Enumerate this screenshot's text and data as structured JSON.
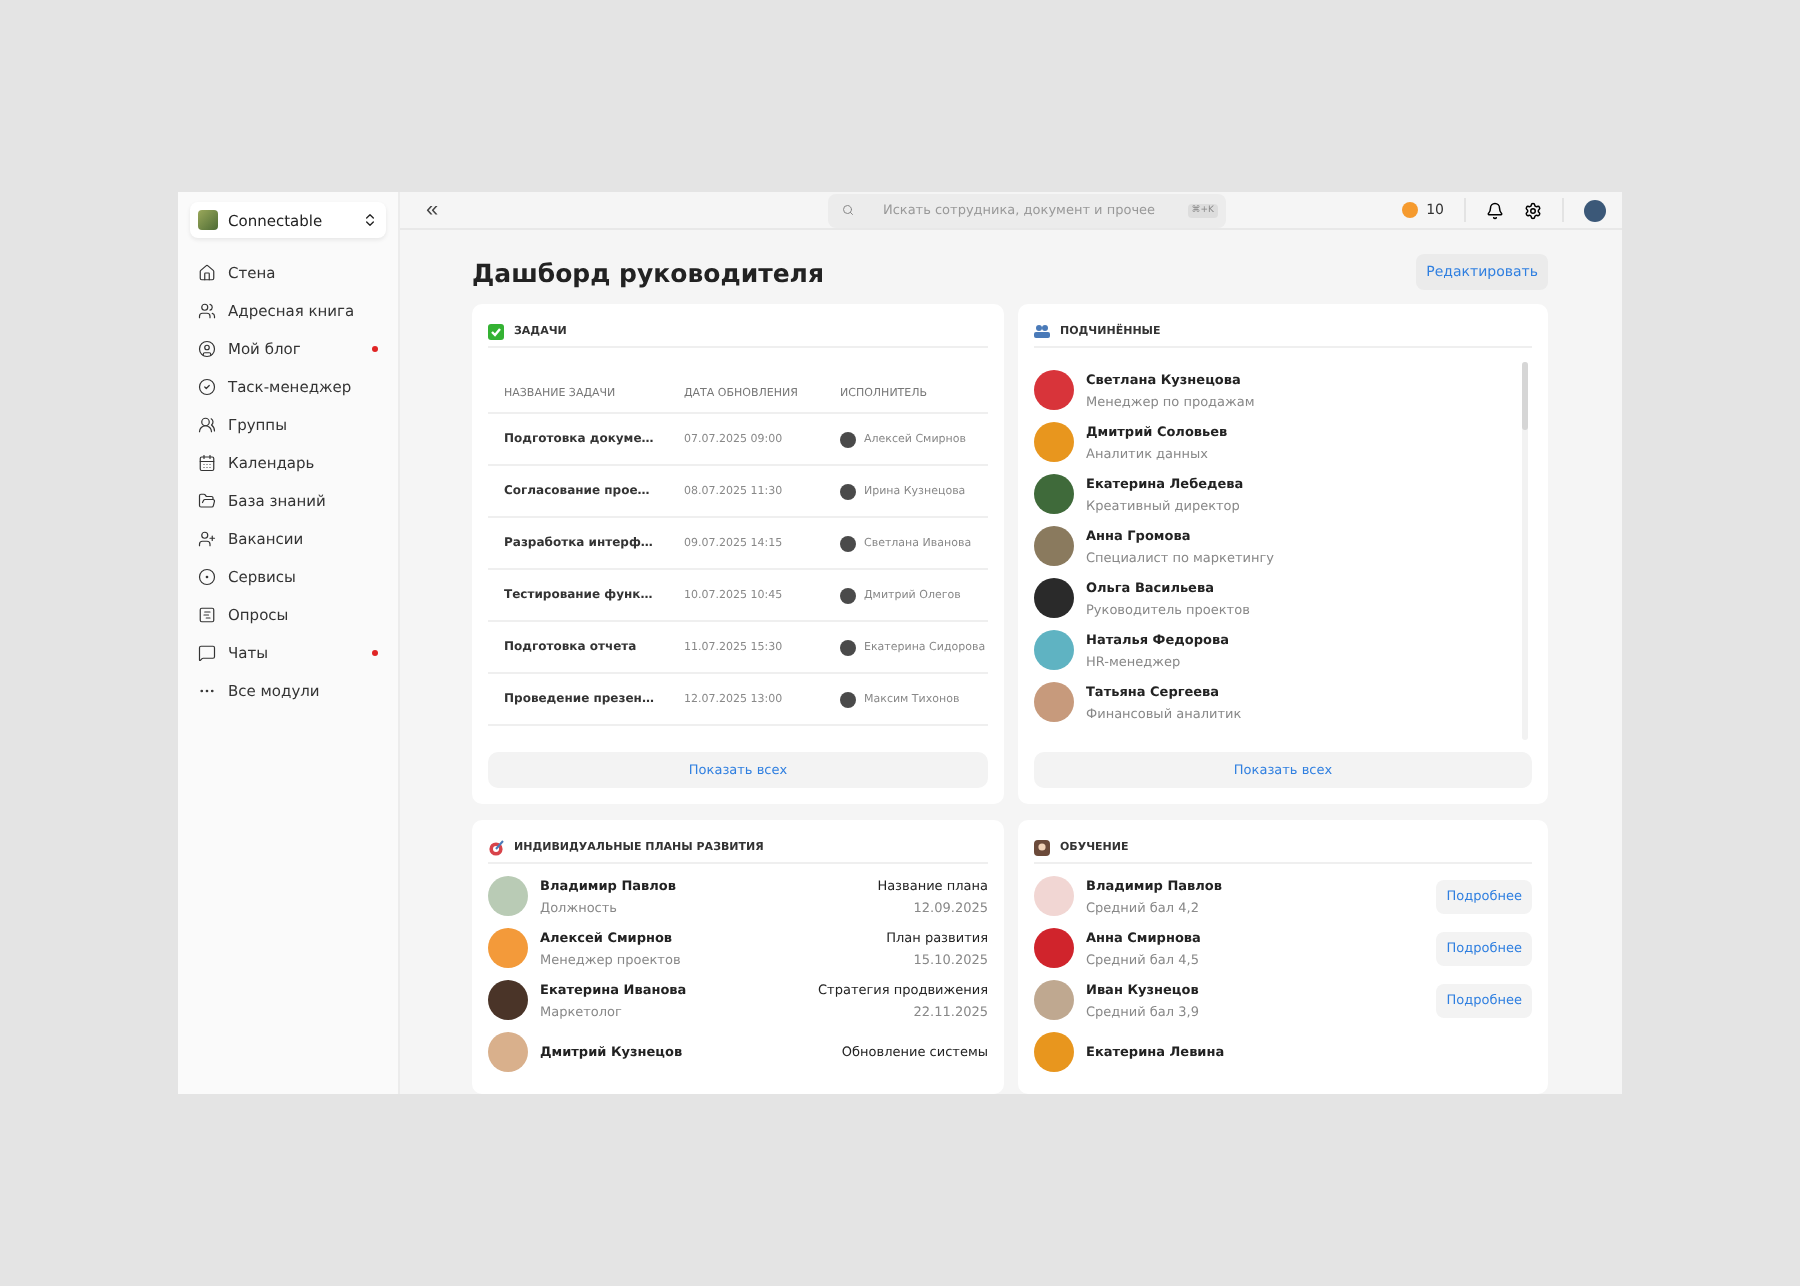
{
  "workspace": {
    "name": "Connectable"
  },
  "sidebar": {
    "items": [
      {
        "label": "Стена",
        "unread": false
      },
      {
        "label": "Адресная книга",
        "unread": false
      },
      {
        "label": "Мой блог",
        "unread": true
      },
      {
        "label": "Таск-менеджер",
        "unread": false
      },
      {
        "label": "Группы",
        "unread": false
      },
      {
        "label": "Календарь",
        "unread": false
      },
      {
        "label": "База знаний",
        "unread": false
      },
      {
        "label": "Вакансии",
        "unread": false
      },
      {
        "label": "Сервисы",
        "unread": false
      },
      {
        "label": "Опросы",
        "unread": false
      },
      {
        "label": "Чаты",
        "unread": true
      },
      {
        "label": "Все модули",
        "unread": false
      }
    ]
  },
  "topbar": {
    "collapse": "«",
    "search": {
      "placeholder": "Искать сотрудника, документ и прочее",
      "shortcut": "⌘+K"
    },
    "coins": "10"
  },
  "page": {
    "title": "Дашборд руководителя",
    "edit_button": "Редактировать"
  },
  "tasks": {
    "title": "ЗАДАЧИ",
    "columns": [
      "НАЗВАНИЕ ЗАДАЧИ",
      "ДАТА ОБНОВЛЕНИЯ",
      "ИСПОЛНИТЕЛЬ"
    ],
    "rows": [
      {
        "name": "Подготовка докуме…",
        "date": "07.07.2025 09:00",
        "assignee": "Алексей Смирнов"
      },
      {
        "name": "Согласование прое…",
        "date": "08.07.2025 11:30",
        "assignee": "Ирина Кузнецова"
      },
      {
        "name": "Разработка интерф…",
        "date": "09.07.2025 14:15",
        "assignee": "Светлана Иванова"
      },
      {
        "name": "Тестирование функ…",
        "date": "10.07.2025 10:45",
        "assignee": "Дмитрий Олегов"
      },
      {
        "name": "Подготовка отчета",
        "date": "11.07.2025 15:30",
        "assignee": "Екатерина Сидорова"
      },
      {
        "name": "Проведение презен…",
        "date": "12.07.2025 13:00",
        "assignee": "Максим Тихонов"
      }
    ],
    "show_all": "Показать всех"
  },
  "subordinates": {
    "title": "ПОДЧИНЁННЫЕ",
    "people": [
      {
        "name": "Светлана Кузнецова",
        "role": "Менеджер по продажам",
        "color": "#d8343a"
      },
      {
        "name": "Дмитрий Соловьев",
        "role": "Аналитик данных",
        "color": "#e8961e"
      },
      {
        "name": "Екатерина Лебедева",
        "role": "Креативный директор",
        "color": "#3f6a3a"
      },
      {
        "name": "Анна Громова",
        "role": "Специалист по маркетингу",
        "color": "#8a7a5e"
      },
      {
        "name": "Ольга Васильева",
        "role": "Руководитель проектов",
        "color": "#2a2a2a"
      },
      {
        "name": "Наталья Федорова",
        "role": "HR-менеджер",
        "color": "#5fb3c2"
      },
      {
        "name": "Татьяна Сергеева",
        "role": "Финансовый аналитик",
        "color": "#c79a7c"
      }
    ],
    "show_all": "Показать всех"
  },
  "plans": {
    "title": "ИНДИВИДУАЛЬНЫЕ ПЛАНЫ РАЗВИТИЯ",
    "rows": [
      {
        "name": "Владимир Павлов",
        "role": "Должность",
        "plan": "Название плана",
        "date": "12.09.2025",
        "color": "#b9cbb5"
      },
      {
        "name": "Алексей Смирнов",
        "role": "Менеджер проектов",
        "plan": "План развития",
        "date": "15.10.2025",
        "color": "#f39a3a"
      },
      {
        "name": "Екатерина Иванова",
        "role": "Маркетолог",
        "plan": "Стратегия продвижения",
        "date": "22.11.2025",
        "color": "#4a3428"
      },
      {
        "name": "Дмитрий Кузнецов",
        "plan": "Обновление системы",
        "color": "#d9b08c"
      }
    ]
  },
  "education": {
    "title": "ОБУЧЕНИЕ",
    "rows": [
      {
        "name": "Владимир Павлов",
        "score": "Средний бал 4,2",
        "button": "Подробнее",
        "color": "#f1d6d3"
      },
      {
        "name": "Анна Смирнова",
        "score": "Средний бал 4,5",
        "button": "Подробнее",
        "color": "#d0242c"
      },
      {
        "name": "Иван Кузнецов",
        "score": "Средний бал 3,9",
        "button": "Подробнее",
        "color": "#bfa890"
      },
      {
        "name": "Екатерина Левина",
        "color": "#e8961e"
      }
    ]
  }
}
